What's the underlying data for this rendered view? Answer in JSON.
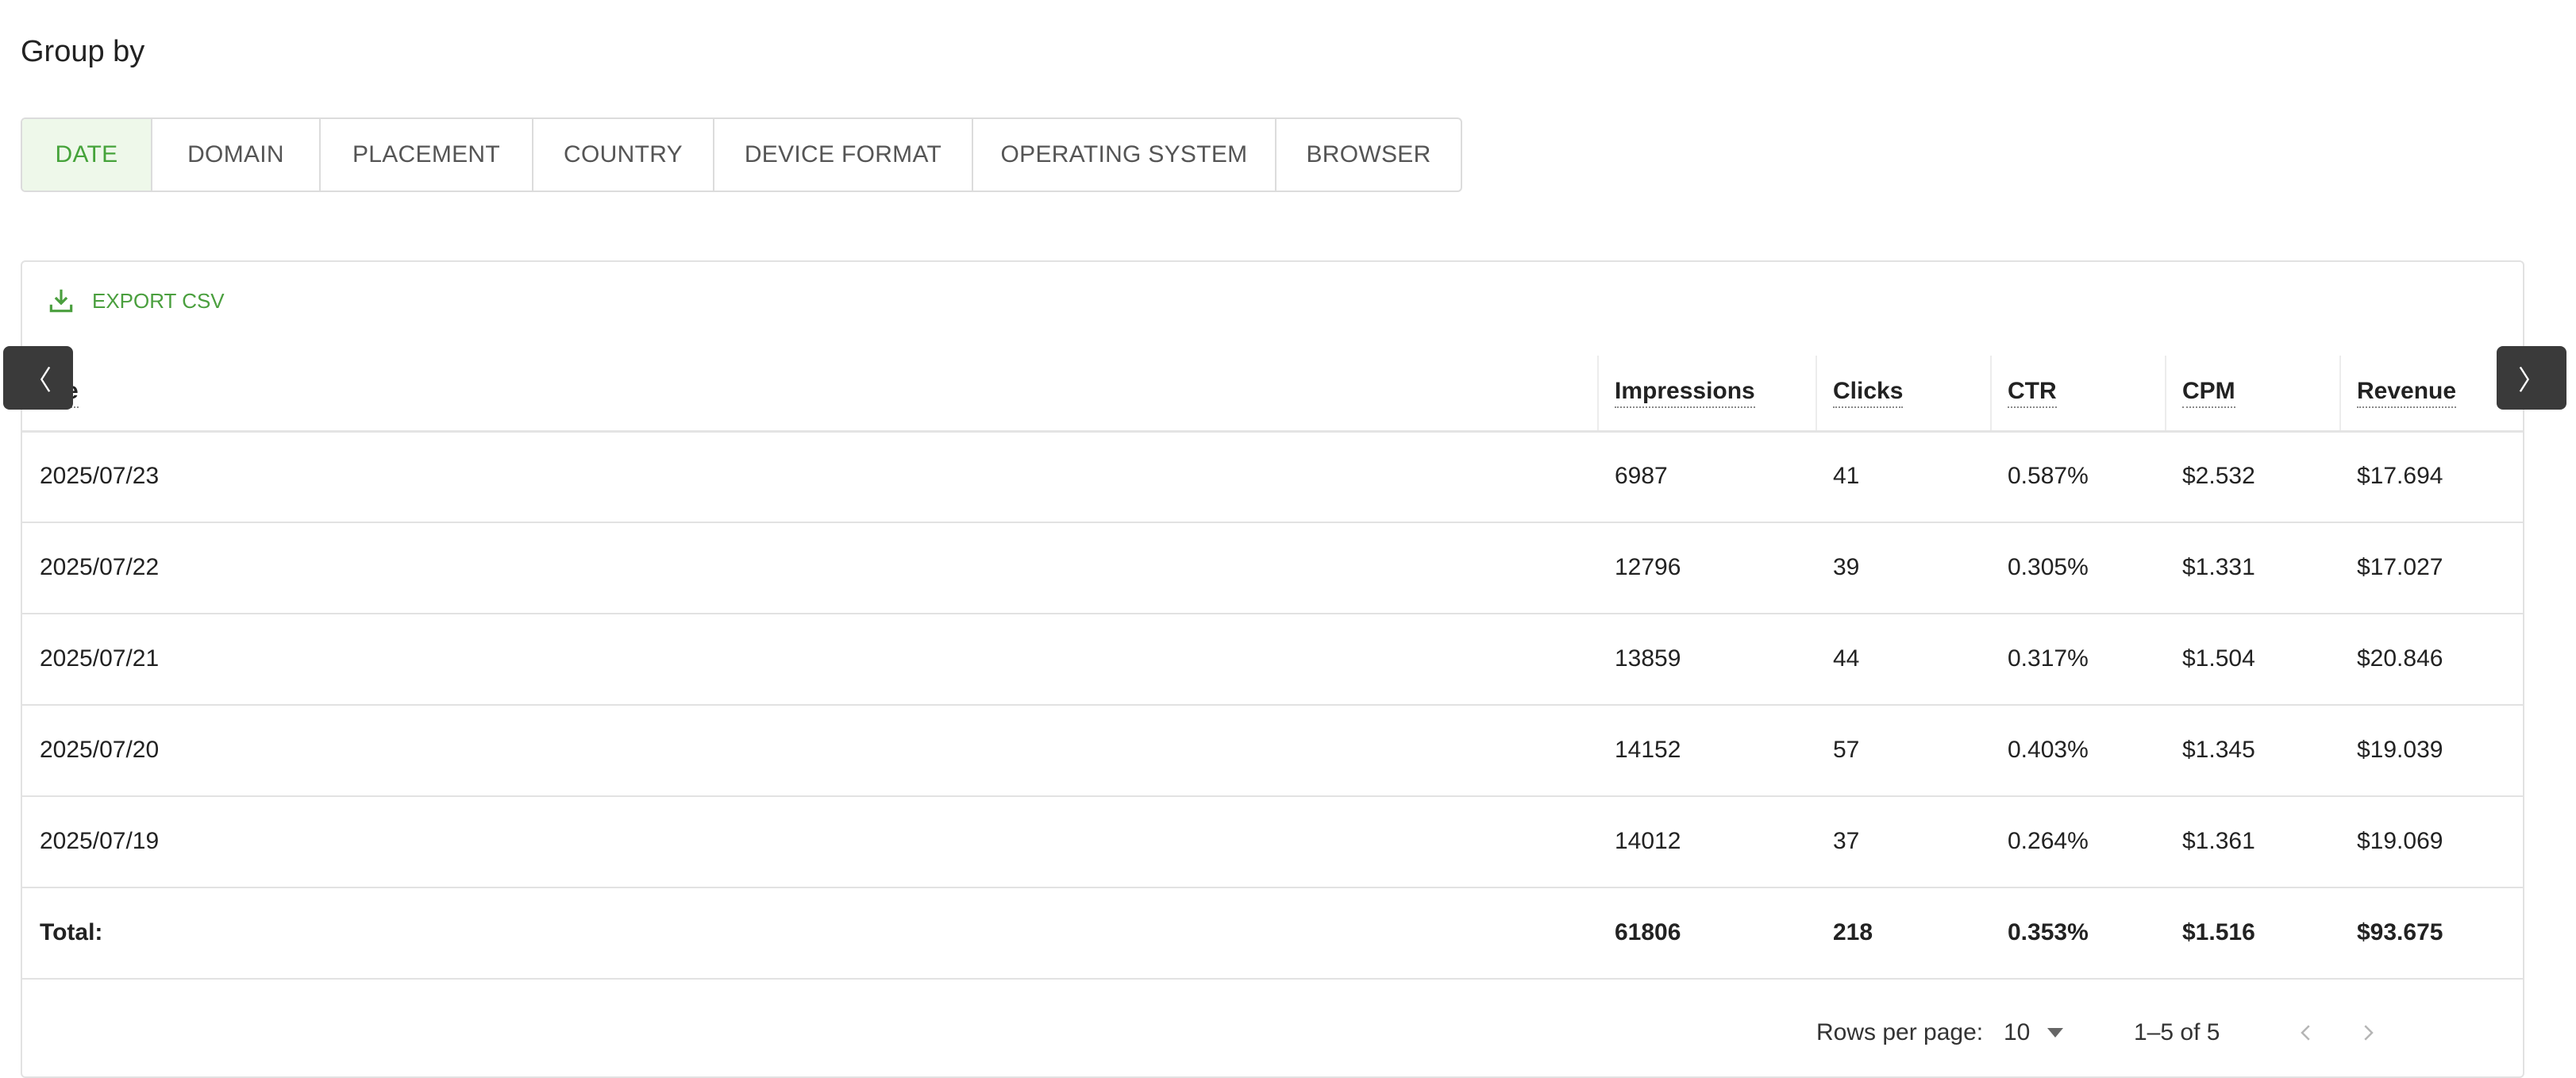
{
  "group_by": {
    "title": "Group by",
    "tabs": [
      {
        "label": "DATE",
        "active": true
      },
      {
        "label": "DOMAIN",
        "active": false
      },
      {
        "label": "PLACEMENT",
        "active": false
      },
      {
        "label": "COUNTRY",
        "active": false
      },
      {
        "label": "DEVICE FORMAT",
        "active": false
      },
      {
        "label": "OPERATING SYSTEM",
        "active": false
      },
      {
        "label": "BROWSER",
        "active": false
      }
    ]
  },
  "table": {
    "export_label": "EXPORT CSV",
    "columns": [
      "te",
      "Impressions",
      "Clicks",
      "CTR",
      "CPM",
      "Revenue"
    ],
    "rows": [
      [
        "2025/07/23",
        "6987",
        "41",
        "0.587%",
        "$2.532",
        "$17.694"
      ],
      [
        "2025/07/22",
        "12796",
        "39",
        "0.305%",
        "$1.331",
        "$17.027"
      ],
      [
        "2025/07/21",
        "13859",
        "44",
        "0.317%",
        "$1.504",
        "$20.846"
      ],
      [
        "2025/07/20",
        "14152",
        "57",
        "0.403%",
        "$1.345",
        "$19.039"
      ],
      [
        "2025/07/19",
        "14012",
        "37",
        "0.264%",
        "$1.361",
        "$19.069"
      ]
    ],
    "total": [
      "Total:",
      "61806",
      "218",
      "0.353%",
      "$1.516",
      "$93.675"
    ]
  },
  "pagination": {
    "rows_per_page_label": "Rows per page:",
    "rows_per_page_value": "10",
    "range": "1–5 of 5"
  },
  "scroll_arrows": {
    "left": "〈",
    "right": "〉"
  },
  "colors": {
    "accent": "#45a33a",
    "active_tab_bg": "#eef8ea",
    "arrow_bg": "#3a3a3a"
  }
}
